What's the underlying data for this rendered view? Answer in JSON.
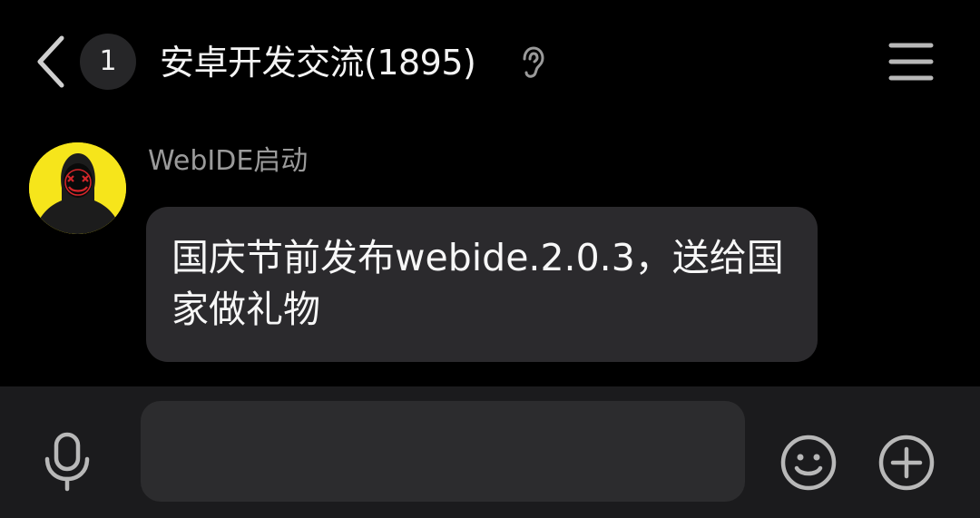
{
  "header": {
    "back_icon": "chevron-left-icon",
    "unread_count": "1",
    "title": "安卓开发交流(1895)",
    "earpiece_icon": "ear-icon",
    "menu_icon": "hamburger-menu-icon"
  },
  "messages": [
    {
      "sender": "WebIDE启动",
      "avatar_icon": "avatar-hooded-figure",
      "text": "国庆节前发布webide.2.0.3，送给国家做礼物"
    }
  ],
  "input_bar": {
    "voice_icon": "microphone-icon",
    "input_value": "",
    "emoji_icon": "smiley-icon",
    "more_icon": "plus-circle-icon"
  },
  "colors": {
    "background": "#000000",
    "bubble": "#2b2a2d",
    "input_bar": "#1b1b1d",
    "input_field": "#2c2c2e",
    "avatar_bg": "#f6e51b",
    "sender_name": "#9a9a9a",
    "icon": "#b8b8b8"
  }
}
